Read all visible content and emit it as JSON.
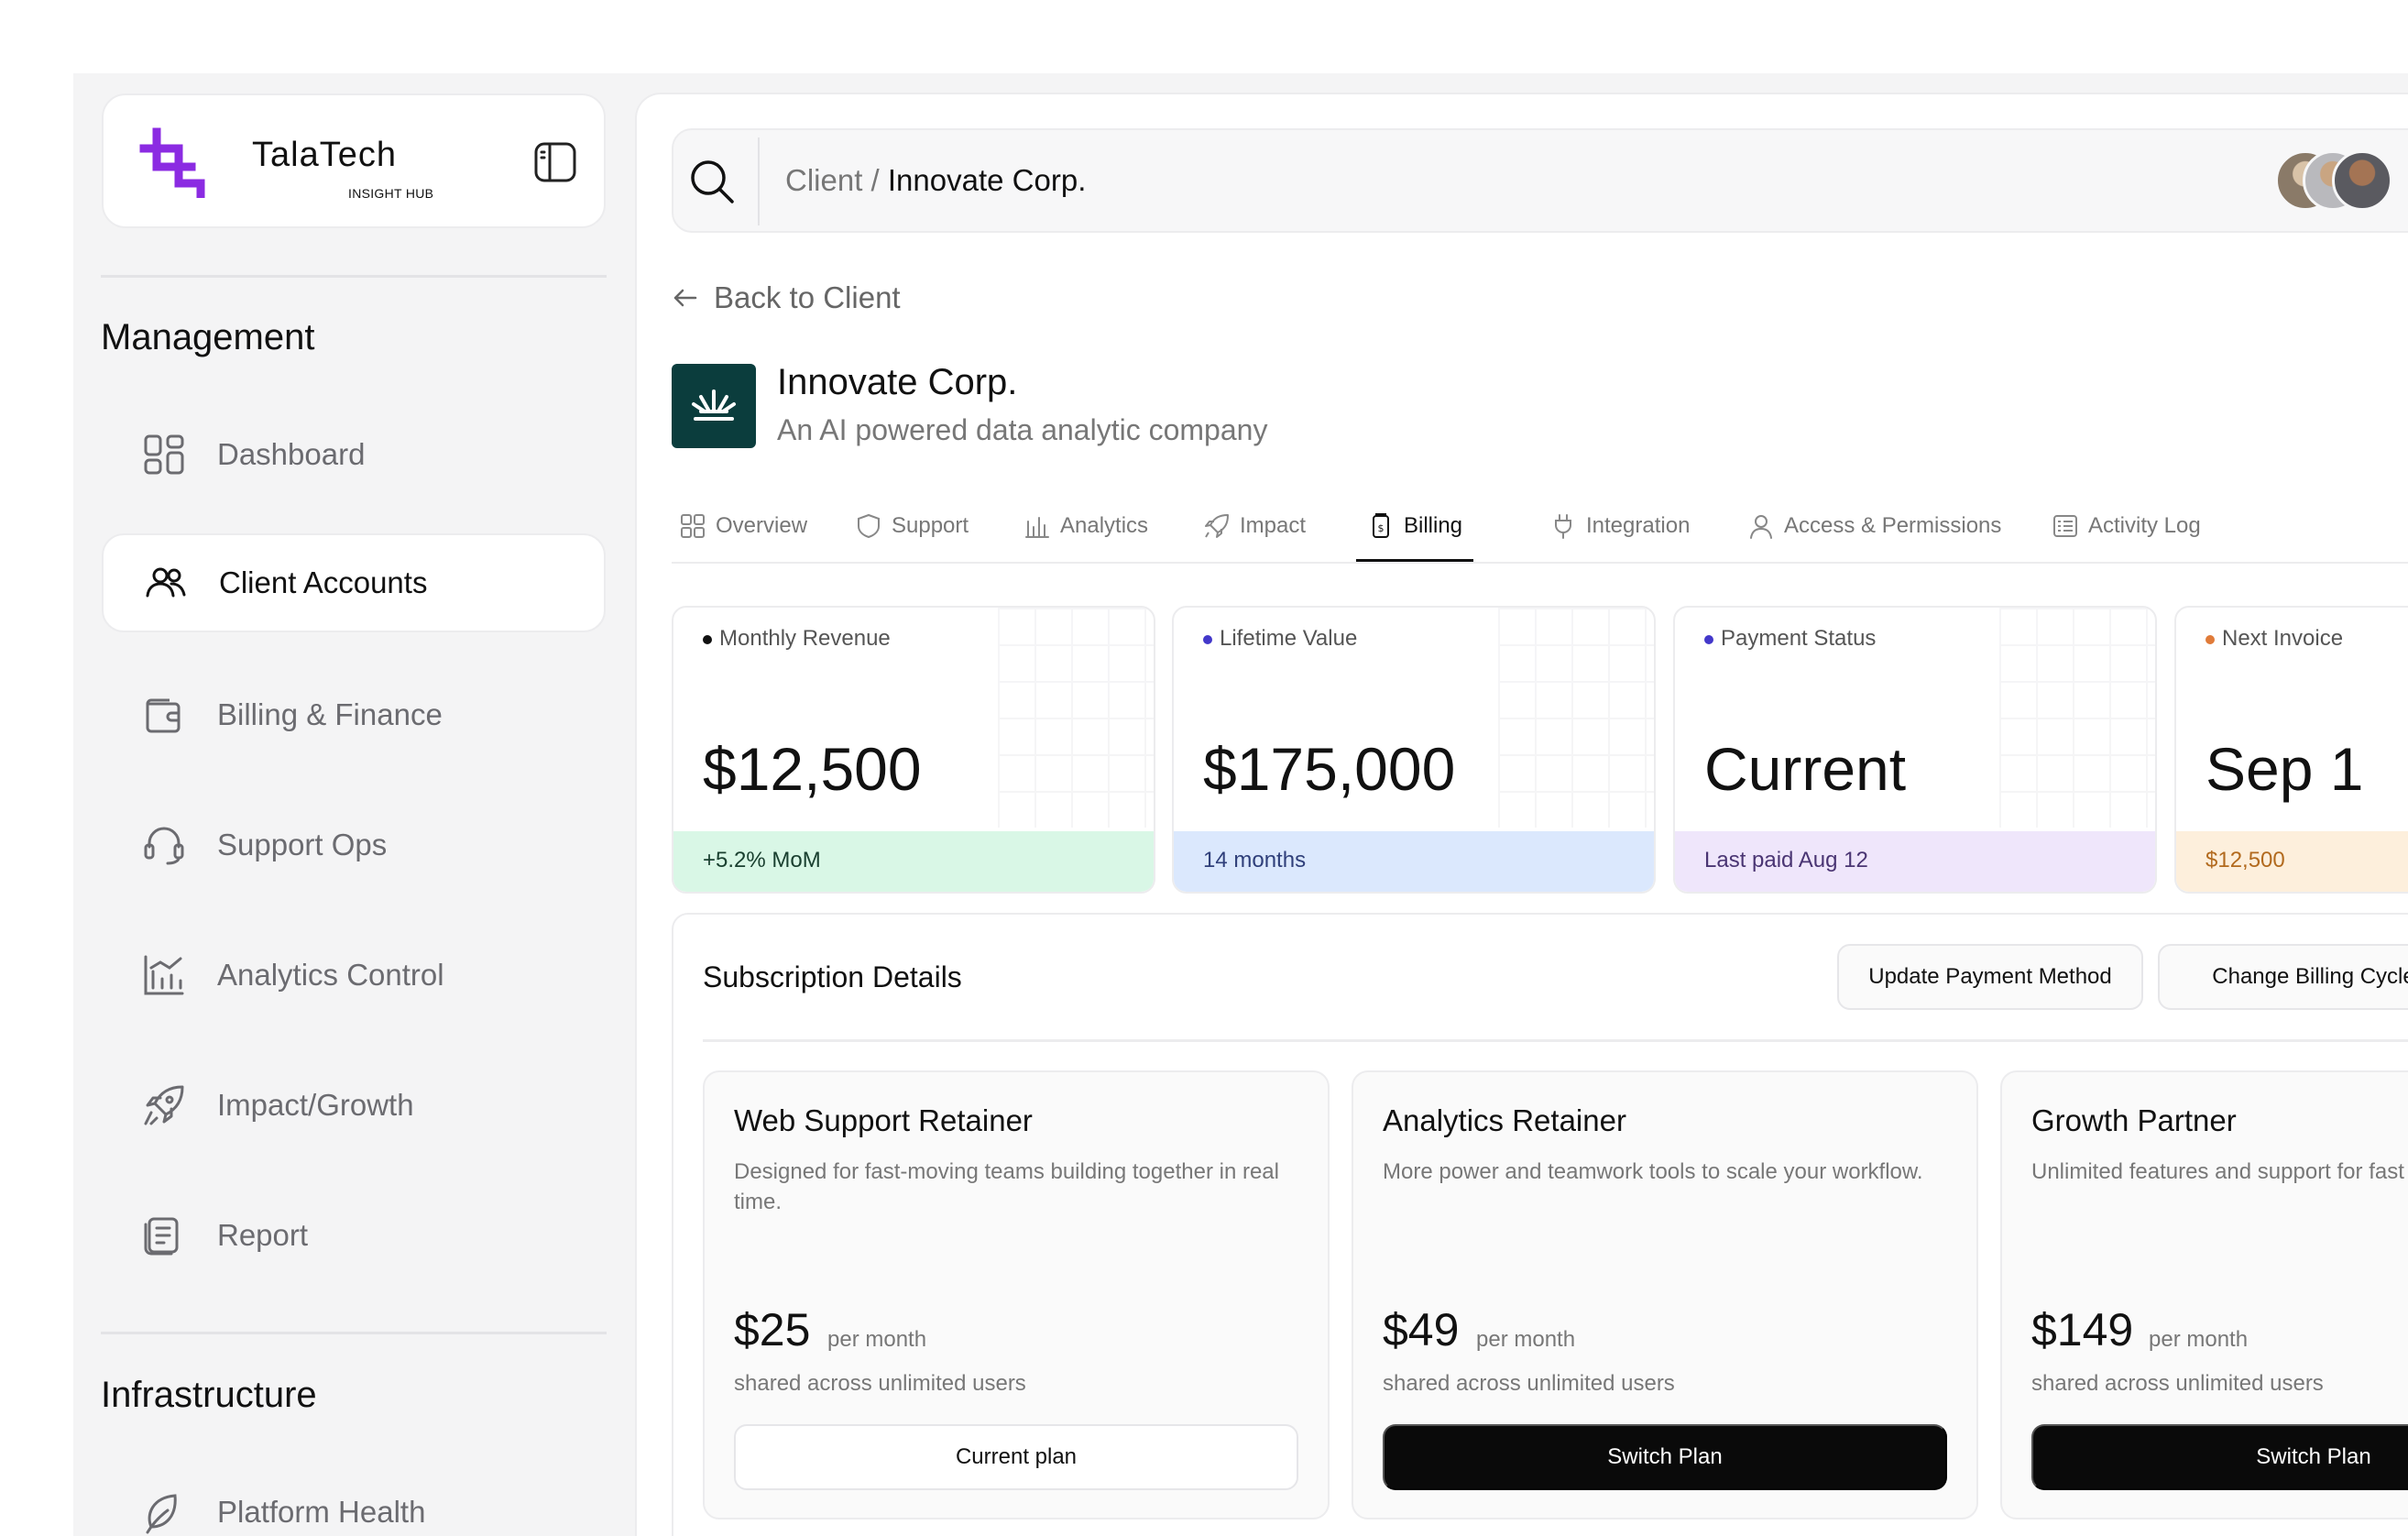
{
  "brand": {
    "name": "TalaTech",
    "sub": "INSIGHT HUB",
    "accent": "#8b2be2"
  },
  "sidebar": {
    "sections": [
      {
        "title": "Management"
      },
      {
        "title": "Infrastructure"
      }
    ],
    "items": [
      {
        "label": "Dashboard",
        "icon": "grid-icon",
        "active": false
      },
      {
        "label": "Client Accounts",
        "icon": "users-icon",
        "active": true
      },
      {
        "label": "Billing & Finance",
        "icon": "wallet-icon",
        "active": false
      },
      {
        "label": "Support Ops",
        "icon": "headset-icon",
        "active": false
      },
      {
        "label": "Analytics Control",
        "icon": "chart-icon",
        "active": false
      },
      {
        "label": "Impact/Growth",
        "icon": "rocket-icon",
        "active": false
      },
      {
        "label": "Report",
        "icon": "document-icon",
        "active": false
      },
      {
        "label": "Platform Health",
        "icon": "leaf-icon",
        "active": false
      }
    ]
  },
  "header": {
    "breadcrumb": {
      "parent": "Client",
      "separator": " / ",
      "current": "Innovate Corp."
    }
  },
  "back_link": "Back to Client",
  "company": {
    "name": "Innovate Corp.",
    "description": "An AI powered data analytic company",
    "logo_color": "#0b3d3d"
  },
  "tabs": [
    {
      "label": "Overview",
      "icon": "grid-icon"
    },
    {
      "label": "Support",
      "icon": "shield-icon"
    },
    {
      "label": "Analytics",
      "icon": "bars-icon"
    },
    {
      "label": "Impact",
      "icon": "rocket-icon"
    },
    {
      "label": "Billing",
      "icon": "receipt-icon",
      "active": true
    },
    {
      "label": "Integration",
      "icon": "plug-icon"
    },
    {
      "label": "Access & Permissions",
      "icon": "user-icon"
    },
    {
      "label": "Activity Log",
      "icon": "list-icon"
    }
  ],
  "stats": [
    {
      "label": "Monthly Revenue",
      "value": "$12,500",
      "foot": "+5.2% MoM",
      "dot": "#111111",
      "foot_bg": "#d9f7e6",
      "foot_color": "#1a4030"
    },
    {
      "label": "Lifetime Value",
      "value": "$175,000",
      "foot": "14 months",
      "dot": "#4338ca",
      "foot_bg": "#dbe8fd",
      "foot_color": "#2f3f7a"
    },
    {
      "label": "Payment Status",
      "value": "Current",
      "foot": "Last paid Aug 12",
      "dot": "#4338ca",
      "foot_bg": "#efe6fb",
      "foot_color": "#4a3573"
    },
    {
      "label": "Next Invoice",
      "value": "Sep 1",
      "foot": "$12,500",
      "dot": "#e07b39",
      "foot_bg": "#fdefdc",
      "foot_color": "#b26a1e"
    }
  ],
  "subscription": {
    "title": "Subscription Details",
    "update_payment": "Update Payment Method",
    "change_cycle": "Change Billing Cycle",
    "plans": [
      {
        "name": "Web Support Retainer",
        "desc": "Designed for fast-moving teams building together in real time.",
        "price": "$25",
        "per": "per month",
        "shared": "shared across unlimited users",
        "button": "Current plan",
        "current": true
      },
      {
        "name": "Analytics Retainer",
        "desc": "More power and teamwork tools to scale your workflow.",
        "price": "$49",
        "per": "per month",
        "shared": "shared across unlimited users",
        "button": "Switch Plan",
        "current": false
      },
      {
        "name": "Growth Partner",
        "desc": "Unlimited features and support for fast teams.",
        "price": "$149",
        "per": "per month",
        "shared": "shared across unlimited users",
        "button": "Switch Plan",
        "current": false
      }
    ]
  }
}
